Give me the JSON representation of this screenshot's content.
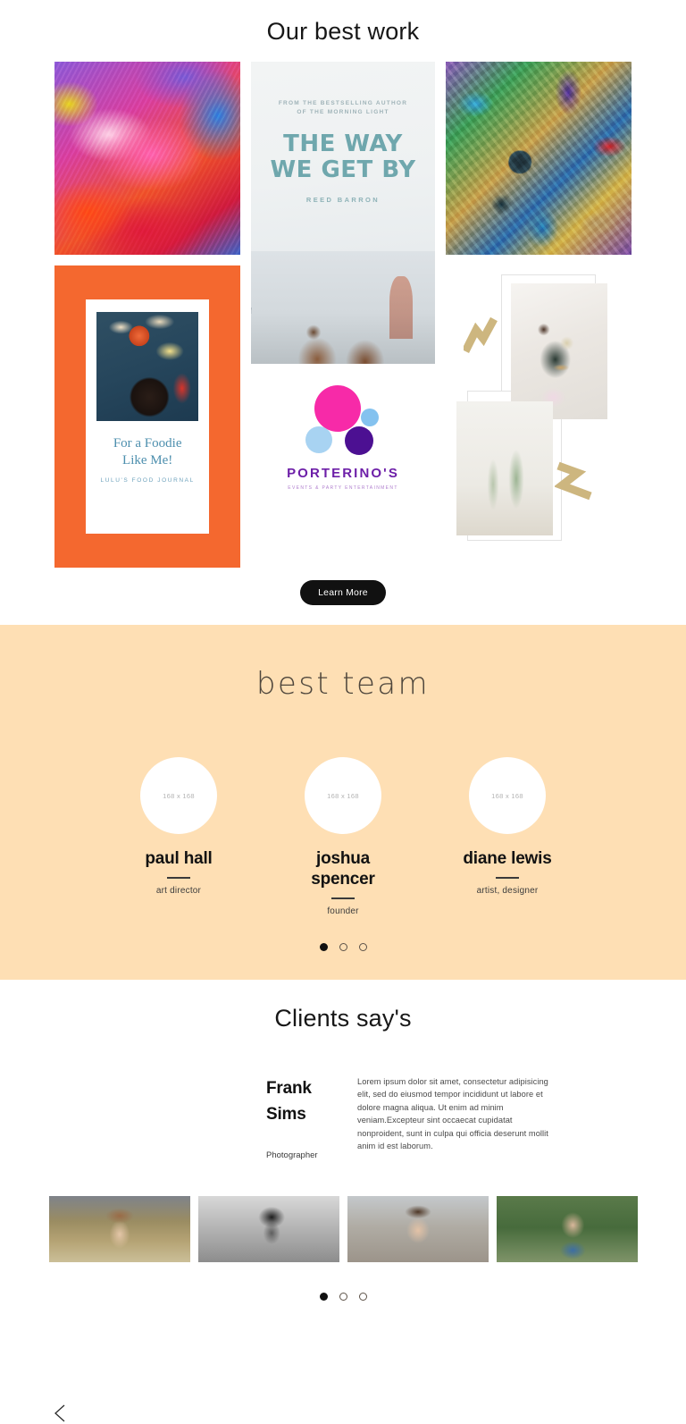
{
  "work": {
    "title": "Our best work",
    "learn_more_label": "Learn More",
    "items": {
      "paint": {
        "name": "abstract-paint-artwork"
      },
      "book": {
        "kicker_line1": "FROM THE BESTSELLING AUTHOR",
        "kicker_line2": "OF THE MORNING LIGHT",
        "title_line1": "THE WAY",
        "title_line2": "WE GET BY",
        "author": "REED BARRON"
      },
      "graffiti": {
        "name": "graffiti-mural-artwork"
      },
      "foodie": {
        "headline_line1": "For a Foodie",
        "headline_line2": "Like Me!",
        "subline": "LULU'S FOOD JOURNAL"
      },
      "friends": {
        "name": "friends-photo"
      },
      "logo": {
        "name": "PORTERINO'S",
        "tagline": "EVENTS & PARTY ENTERTAINMENT"
      },
      "moodboard": {
        "name": "moodboard-collage"
      }
    }
  },
  "team": {
    "title": "best team",
    "prev_label": "‹",
    "next_label": "›",
    "members": [
      {
        "placeholder": "168 x 168",
        "name": "paul hall",
        "role": "art director"
      },
      {
        "placeholder": "168 x 168",
        "name": "joshua spencer",
        "role": "founder"
      },
      {
        "placeholder": "168 x 168",
        "name": "diane lewis",
        "role": "artist, designer"
      }
    ],
    "pagination": {
      "active_index": 0,
      "count": 3
    }
  },
  "clients": {
    "title": "Clients say's",
    "testimonial": {
      "name_line1": "Frank",
      "name_line2": "Sims",
      "role": "Photographer",
      "quote": "Lorem ipsum dolor sit amet, consectetur adipisicing elit, sed do eiusmod tempor incididunt ut labore et dolore magna aliqua. Ut enim ad minim veniam.Excepteur sint occaecat cupidatat nonproident, sunt in culpa qui officia deserunt mollit anim id est laborum."
    },
    "thumbnails": [
      {
        "name": "client-thumb-woman-hat"
      },
      {
        "name": "client-thumb-woman-bw"
      },
      {
        "name": "client-thumb-young-man"
      },
      {
        "name": "client-thumb-older-man"
      }
    ],
    "pagination": {
      "active_index": 0,
      "count": 3
    }
  },
  "colors": {
    "team_background": "#fedfb4",
    "foodie_orange": "#f4682f",
    "book_teal": "#6fa7ad",
    "logo_purple": "#6d1fa8",
    "logo_pink": "#f72aa8",
    "button_black": "#111111"
  }
}
